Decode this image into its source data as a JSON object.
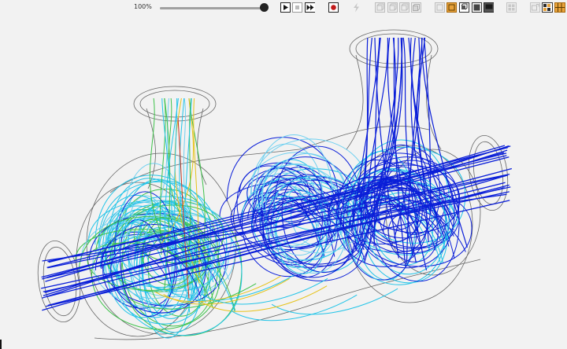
{
  "toolbar": {
    "zoom_label": "100%",
    "zoom_value_percent": 100,
    "buttons": [
      {
        "name": "play-button",
        "icon": "play-icon",
        "active": false
      },
      {
        "name": "stop-button",
        "icon": "stop-icon",
        "active": false
      },
      {
        "name": "fast-forward-button",
        "icon": "fast-forward-icon",
        "active": false
      },
      {
        "name": "record-button",
        "icon": "record-icon",
        "active": false
      },
      {
        "name": "lightning-button",
        "icon": "lightning-icon",
        "active": false
      },
      {
        "name": "view-front-button",
        "icon": "cube-front-icon",
        "active": false
      },
      {
        "name": "view-side-button",
        "icon": "cube-side-icon",
        "active": false
      },
      {
        "name": "view-top-button",
        "icon": "cube-top-icon",
        "active": false
      },
      {
        "name": "view-iso-button",
        "icon": "cube-iso-icon",
        "active": false
      },
      {
        "name": "display-outline-button",
        "icon": "outline-icon",
        "active": false
      },
      {
        "name": "display-surface-button",
        "icon": "surface-icon",
        "active": true
      },
      {
        "name": "display-edges-button",
        "icon": "edges-icon",
        "active": false
      },
      {
        "name": "display-solid-button",
        "icon": "solid-icon",
        "active": false
      },
      {
        "name": "settings-button",
        "icon": "settings-icon",
        "active": false
      },
      {
        "name": "export-button",
        "icon": "export-icon",
        "active": false
      },
      {
        "name": "palette-button",
        "icon": "palette-icon",
        "active": true
      }
    ]
  },
  "scene": {
    "type": "streamline-visualization",
    "colors": {
      "outline": "#666666",
      "streamline_main": "#0a1ed8",
      "streamline_cyan": "#21c4e8",
      "streamline_light": "#6fd0f0",
      "streamline_green": "#3ec24a",
      "streamline_yellow": "#e6c21a",
      "streamline_red": "#c8321e",
      "background": "#f2f2f2"
    }
  }
}
